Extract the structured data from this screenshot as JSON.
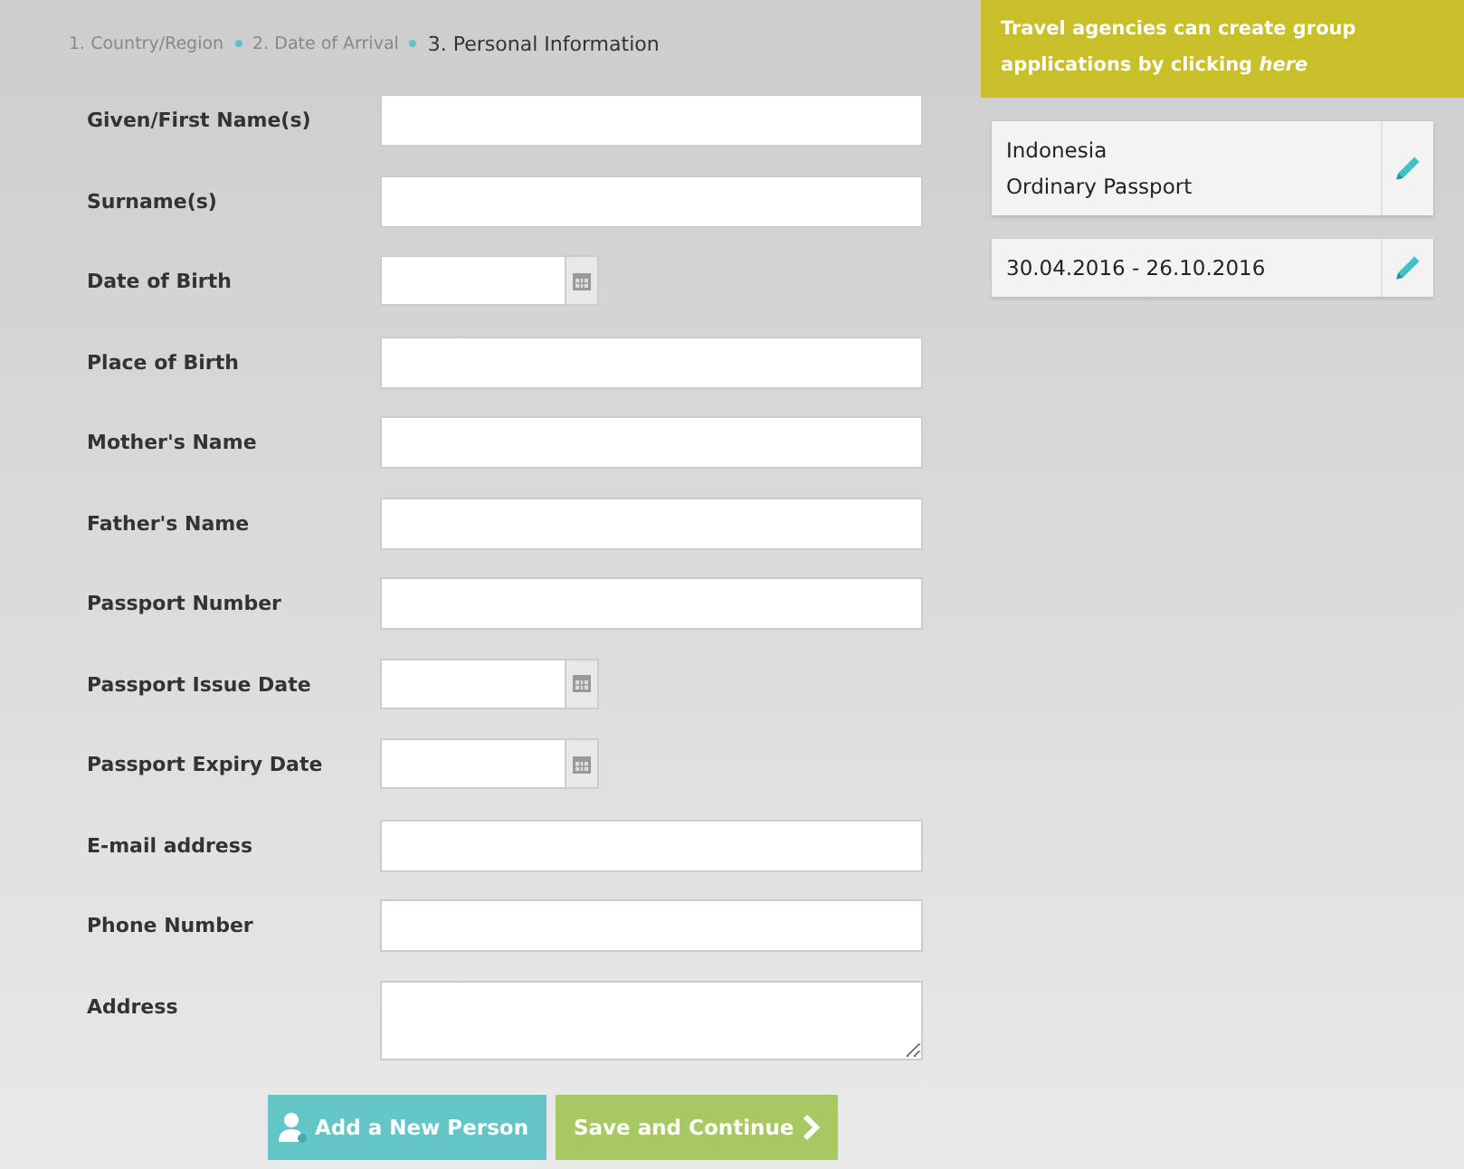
{
  "steps": [
    {
      "label": "1. Country/Region",
      "selected": false
    },
    {
      "label": "2. Date of Arrival",
      "selected": false
    },
    {
      "label": "3. Personal Information",
      "selected": true
    }
  ],
  "fields": [
    {
      "label": "Given/First Name(s)",
      "kind": "text"
    },
    {
      "label": "Surname(s)",
      "kind": "text"
    },
    {
      "label": "Date of Birth",
      "kind": "date"
    },
    {
      "label": "Place of Birth",
      "kind": "text"
    },
    {
      "label": "Mother's Name",
      "kind": "text"
    },
    {
      "label": "Father's Name",
      "kind": "text"
    },
    {
      "label": "Passport Number",
      "kind": "text"
    },
    {
      "label": "Passport Issue Date",
      "kind": "date"
    },
    {
      "label": "Passport Expiry Date",
      "kind": "date"
    },
    {
      "label": "E-mail address",
      "kind": "text"
    },
    {
      "label": "Phone Number",
      "kind": "text"
    },
    {
      "label": "Address",
      "kind": "textarea"
    }
  ],
  "buttons": [
    {
      "label": "Add a New Person",
      "kind": "add"
    },
    {
      "label": "Save and Continue",
      "kind": "save"
    }
  ],
  "banner": {
    "lines": [
      "Travel agencies can create group",
      "applications by clicking"
    ],
    "link": "here"
  },
  "cards": [
    {
      "lines": [
        "Indonesia",
        "Ordinary Passport"
      ]
    },
    {
      "lines": [
        "30.04.2016 - 26.10.2016"
      ]
    }
  ]
}
